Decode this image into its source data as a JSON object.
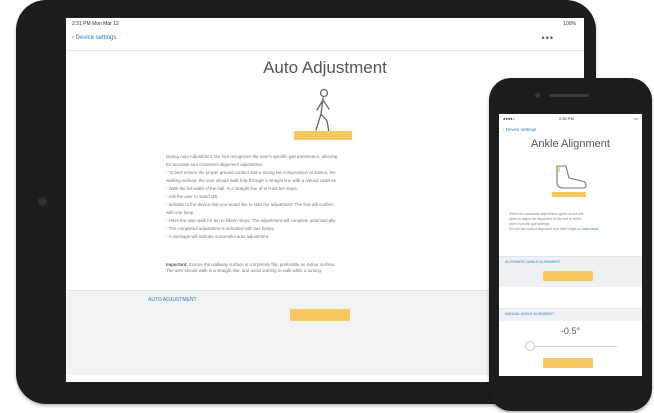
{
  "tablet": {
    "status": {
      "time_date": "2:31 PM  Mon Mar 12",
      "battery": "100%"
    },
    "nav": {
      "back_label": "Device settings",
      "more_icon": "ellipsis-icon"
    },
    "title": "Auto Adjustment",
    "body_lines": [
      "During Auto Adjustment, the foot recognizes the user's specific gait parameters, allowing",
      "for accurate and consistent alignment adjustment.",
      "- To best ensure the proper ground contact and a strong toe compression at stance, the",
      "walking surface, the user should walk fully through a straight line with a natural cadence.",
      "- Walk the full width of the hall, in a straight line of at least ten steps.",
      "- Ask the user to stand still.",
      "- Indicate to the device that you would like to start the adjustment. The foot will confirm",
      "with one beep.",
      "- Have the user walk for ten to fifteen steps. The adjustment will complete automatically.",
      "- The completed adjustment is indicated with two beeps.",
      "- A message will indicate successful auto adjustment."
    ],
    "important_label": "Important:",
    "important_lines": [
      " Ensure the walkway surface is completely flat, preferably an indoor surface.",
      "The user should walk in a straight line, and avoid starting to walk while a turning."
    ],
    "section_label": "AUTO ADJUSTMENT",
    "auto_button_label": ""
  },
  "phone": {
    "status": {
      "carrier": "●●●●○",
      "time": "2:50 PM",
      "battery": ""
    },
    "nav": {
      "back_label": "Device settings"
    },
    "title": "Ankle Alignment",
    "body_lines": [
      "Select the automatic adjustment option or use the",
      "slider to adjust the alignment of the foot to fit the",
      "user's specific gait settings.",
      "Ensure the correct alignment and heel height of"
    ],
    "body_link": "Learn more",
    "auto_section_label": "AUTOMATIC ANKLE ALIGNMENT",
    "manual_section_label": "MANUAL ANKLE ALIGNMENT",
    "value": "-0.5°",
    "slider_level": 0.05
  },
  "colors": {
    "accent": "#2d7ec4",
    "button": "#f7c862",
    "device": "#1c1d1f"
  }
}
